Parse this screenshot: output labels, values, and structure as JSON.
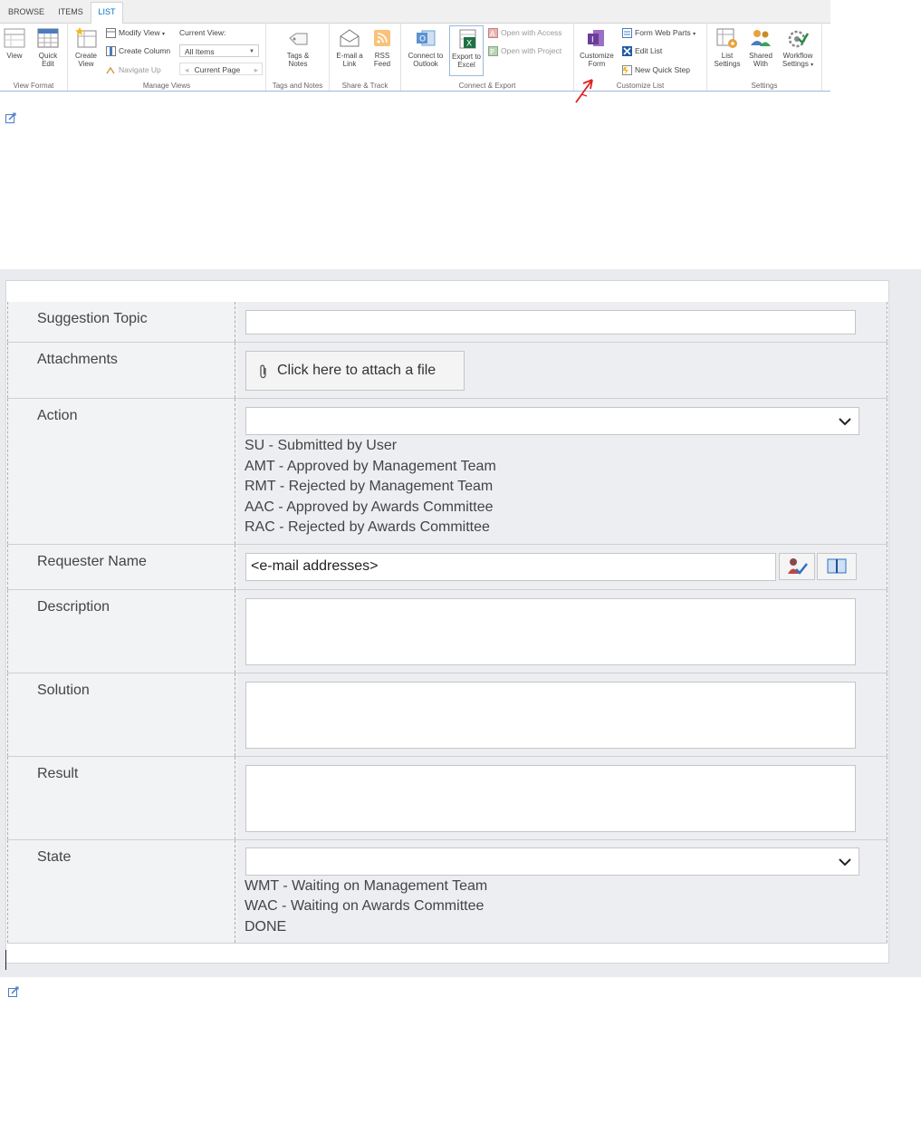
{
  "ribbon": {
    "tabs": [
      "BROWSE",
      "ITEMS",
      "LIST"
    ],
    "groups": {
      "view_format": {
        "label": "View Format",
        "view": "View",
        "quick_edit": "Quick Edit"
      },
      "manage_views": {
        "label": "Manage Views",
        "create_view": "Create View",
        "modify_view": "Modify View",
        "create_column": "Create Column",
        "navigate_up": "Navigate Up",
        "current_view_label": "Current View:",
        "current_view_value": "All Items",
        "current_page": "Current Page"
      },
      "tags_notes": {
        "label": "Tags and Notes",
        "tags_notes": "Tags & Notes"
      },
      "share_track": {
        "label": "Share & Track",
        "email_link": "E-mail a Link",
        "rss_feed": "RSS Feed"
      },
      "connect_export": {
        "label": "Connect & Export",
        "connect_outlook": "Connect to Outlook",
        "export_excel": "Export to Excel",
        "open_access": "Open with Access",
        "open_project": "Open with Project"
      },
      "customize_list": {
        "label": "Customize List",
        "customize_form": "Customize Form",
        "form_web_parts": "Form Web Parts",
        "edit_list": "Edit List",
        "new_quick_step": "New Quick Step"
      },
      "settings": {
        "label": "Settings",
        "list_settings": "List Settings",
        "shared_with": "Shared With",
        "workflow_settings": "Workflow Settings"
      }
    }
  },
  "form": {
    "fields": {
      "suggestion_topic": {
        "label": "Suggestion Topic",
        "value": ""
      },
      "attachments": {
        "label": "Attachments",
        "button": "Click here to attach a file"
      },
      "action": {
        "label": "Action",
        "value": "",
        "options": [
          "SU - Submitted by User",
          "AMT - Approved by Management Team",
          "RMT - Rejected by Management Team",
          "AAC - Approved by Awards Committee",
          "RAC - Rejected by Awards Committee"
        ]
      },
      "requester_name": {
        "label": "Requester Name",
        "value": "<e-mail addresses>"
      },
      "description": {
        "label": "Description",
        "value": ""
      },
      "solution": {
        "label": "Solution",
        "value": ""
      },
      "result": {
        "label": "Result",
        "value": ""
      },
      "state": {
        "label": "State",
        "value": "",
        "options": [
          "WMT - Waiting on Management Team",
          "WAC - Waiting on Awards Committee",
          "DONE"
        ]
      }
    }
  },
  "colors": {
    "accent": "#0072c6",
    "annotation": "#e02020",
    "form_background": "#e9ebee"
  }
}
